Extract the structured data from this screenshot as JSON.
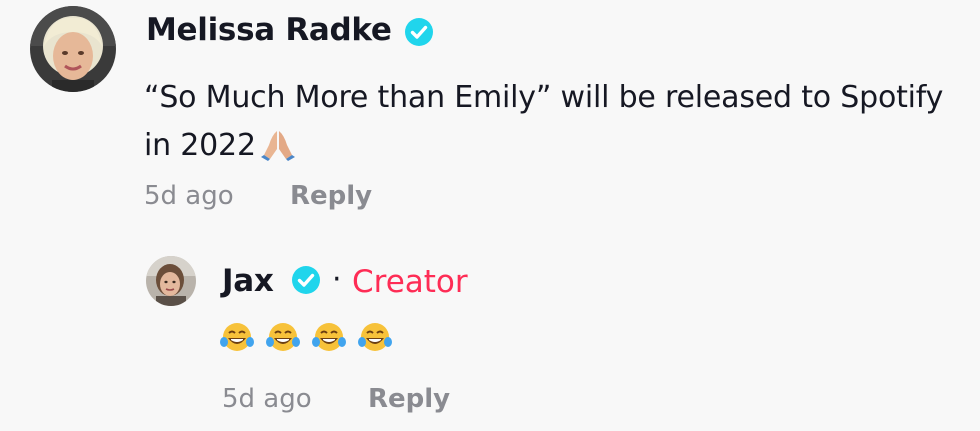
{
  "comment": {
    "author": "Melissa Radke",
    "verified": true,
    "text": "“So Much More than Emily” will be released to Spotify in 2022",
    "emoji": "folded-hands-icon",
    "time": "5d ago",
    "reply_label": "Reply"
  },
  "reply": {
    "author": "Jax",
    "verified": true,
    "separator": "·",
    "tag": "Creator",
    "emojis": [
      "tears-of-joy-icon",
      "tears-of-joy-icon",
      "tears-of-joy-icon",
      "tears-of-joy-icon"
    ],
    "time": "5d ago",
    "reply_label": "Reply"
  },
  "colors": {
    "verified": "#20d5ec",
    "creator": "#fe2c55",
    "meta": "#8a8b91",
    "text": "#161823",
    "background": "#f8f8f8"
  }
}
